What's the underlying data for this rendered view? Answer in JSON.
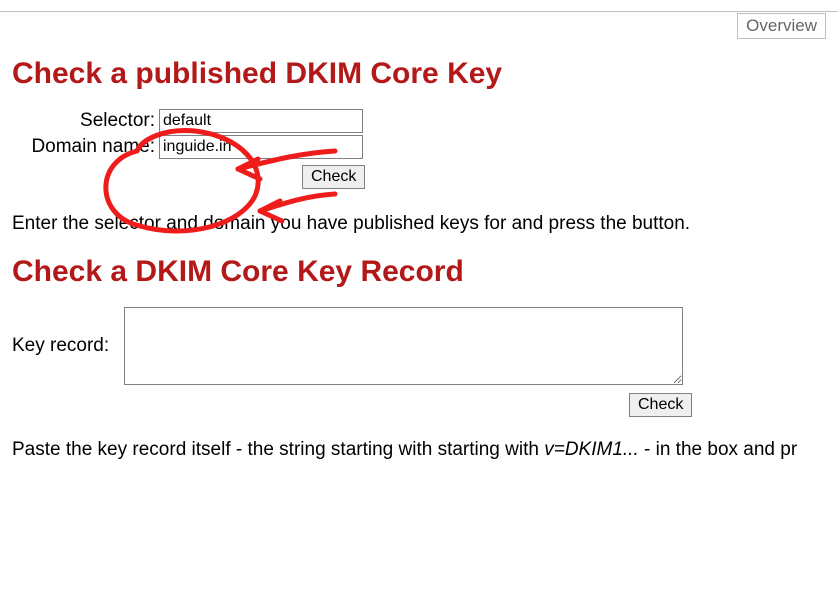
{
  "nav": {
    "overview": "Overview"
  },
  "section1": {
    "heading": "Check a published DKIM Core Key",
    "selector_label": "Selector:",
    "selector_value": "default",
    "domain_label": "Domain name:",
    "domain_value": "inguide.in",
    "check_button": "Check",
    "help": "Enter the selector and domain you have published keys for and press the button."
  },
  "section2": {
    "heading": "Check a DKIM Core Key Record",
    "record_label": "Key record:",
    "record_value": "",
    "check_button": "Check",
    "help_pre": "Paste the key record itself - the string starting with starting with ",
    "help_em": "v=DKIM1...",
    "help_post": " - in the box and pr"
  }
}
